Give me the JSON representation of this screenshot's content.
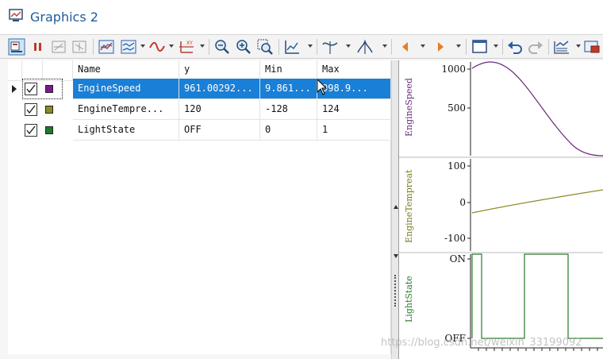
{
  "window": {
    "title": "Graphics 2"
  },
  "toolbar": {
    "buttons": [
      "grid-view-icon",
      "stop-icon",
      "fit-x-icon",
      "fit-y-icon",
      "autoscale-icon",
      "signal-layout-icon",
      "curve-style-icon",
      "axis-icon",
      "zoom-out-icon",
      "zoom-in-icon",
      "zoom-box-icon",
      "chart-icon",
      "cursor-icon",
      "marker-icon",
      "previous-icon",
      "next-icon",
      "window-icon",
      "undo-icon",
      "redo-icon",
      "settings-icon",
      "export-icon"
    ]
  },
  "grid": {
    "headers": {
      "name": "Name",
      "y": "y",
      "min": "Min",
      "max": "Max"
    },
    "rows": [
      {
        "name": "EngineSpeed",
        "y": "961.00292...",
        "min": "9.861...",
        "max": "998.9...",
        "color": "#7a1a8c",
        "checked": true,
        "selected": true
      },
      {
        "name": "EngineTempre...",
        "y": "120",
        "min": "-128",
        "max": "124",
        "color": "#8c8a2a",
        "checked": true,
        "selected": false
      },
      {
        "name": "LightState",
        "y": "OFF",
        "min": "0",
        "max": "1",
        "color": "#1c7a2a",
        "checked": true,
        "selected": false
      }
    ]
  },
  "plots": [
    {
      "label": "EngineSpeed",
      "color": "#6a2a7a",
      "ticks": [
        "1000",
        "500"
      ]
    },
    {
      "label": "EngineTempreat",
      "color": "#7a7a1a",
      "ticks": [
        "100",
        "0",
        "-100"
      ]
    },
    {
      "label": "LightState",
      "color": "#2a7a2a",
      "ticks": [
        "ON",
        "OFF"
      ]
    }
  ],
  "watermark": "https://blog.csdn.net/weixin_33199092"
}
